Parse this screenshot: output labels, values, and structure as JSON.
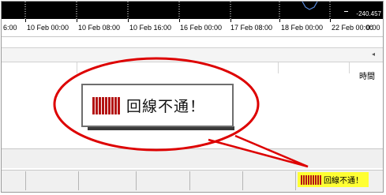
{
  "chart": {
    "price_label": "-240.457"
  },
  "time_axis": {
    "labels": [
      {
        "text": "6:00"
      },
      {
        "text": "10 Feb 00:00"
      },
      {
        "text": "10 Feb 08:00"
      },
      {
        "text": "10 Feb 16:00"
      },
      {
        "text": "16 Feb 00:00"
      },
      {
        "text": "17 Feb 08:00"
      },
      {
        "text": "18 Feb 00:00"
      },
      {
        "text": "22 Feb 00:00"
      },
      {
        "text": "0:00"
      }
    ]
  },
  "panel": {
    "column_header": "時間"
  },
  "status": {
    "connection_text": "回線不通！",
    "connection_color": "#ffff33",
    "icon": "connection-bars-icon"
  },
  "callout": {
    "text": "回線不通！",
    "outline_color": "#dd0000"
  }
}
